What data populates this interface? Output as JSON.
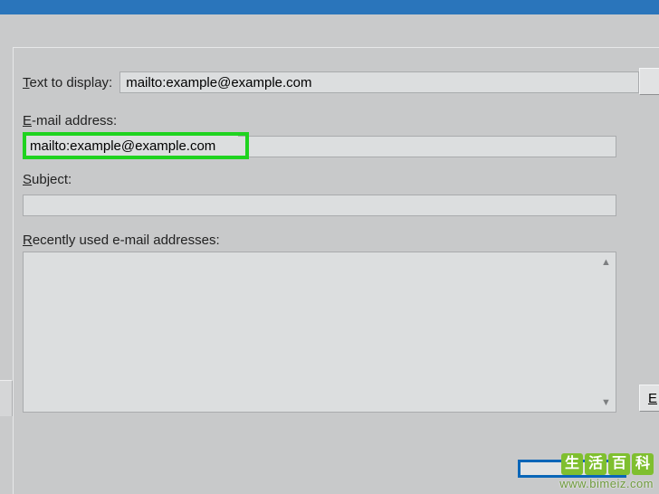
{
  "text_to_display": {
    "label_pre": "T",
    "label_rest": "ext to display:",
    "value": "mailto:example@example.com"
  },
  "email": {
    "label_pre": "E",
    "label_rest": "-mail address:",
    "value": "mailto:example@example.com"
  },
  "subject": {
    "label_pre": "S",
    "label_rest": "ubject:",
    "value": ""
  },
  "recent": {
    "label_pre": "R",
    "label_rest": "ecently used e-mail addresses:"
  },
  "right_button_fragment_text": "",
  "bottom_right_button_fragment_text": "E",
  "watermark": {
    "c1": "生",
    "c2": "活",
    "c3": "百",
    "c4": "科",
    "url": "www.bimeiz.com"
  },
  "colors": {
    "titlebar": "#2a75bb",
    "panel": "#c8c9ca",
    "input_bg": "#dcdedf",
    "highlight": "#1fd31f",
    "primary_button_border": "#0a66b8"
  }
}
